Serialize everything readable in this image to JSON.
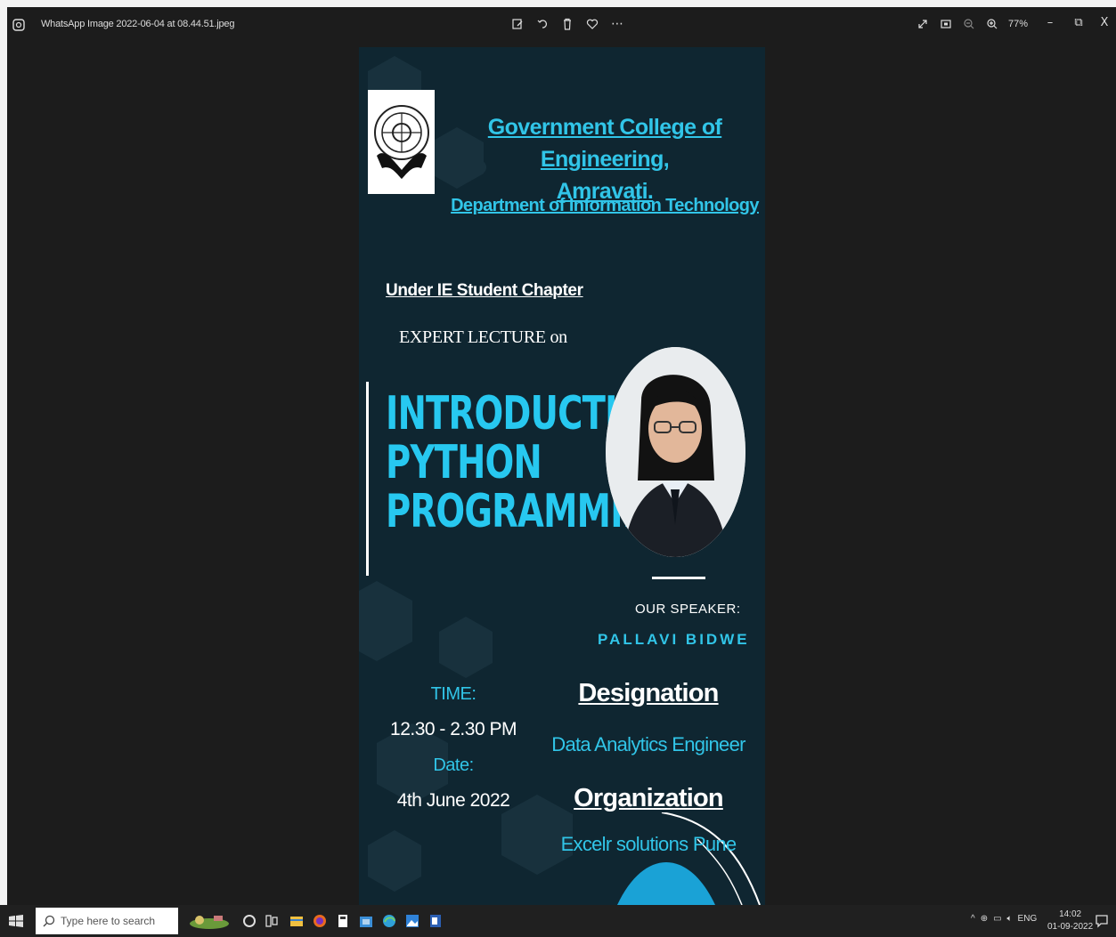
{
  "window": {
    "title": "WhatsApp Image 2022-06-04 at 08.44.51.jpeg",
    "zoom": "77%",
    "toolbar_icons": [
      "edit-icon",
      "rotate-icon",
      "delete-icon",
      "favorite-icon",
      "more-icon"
    ],
    "right_icons": [
      "fullscreen-icon",
      "fit-icon",
      "zoom-out-icon",
      "zoom-in-icon"
    ],
    "controls": {
      "minimize": "–",
      "restore": "⧉",
      "close": "X"
    }
  },
  "poster": {
    "college_line1": "Government College of Engineering,",
    "college_line2": "Amravati.",
    "department": "Department of Information Technology",
    "chapter": "Under IE Student Chapter",
    "lecture_intro": "EXPERT LECTURE on",
    "headline": [
      "INTRODUCTION TO",
      "PYTHON",
      "PROGRAMMING"
    ],
    "speaker_label": "OUR SPEAKER:",
    "speaker_name": "PALLAVI BIDWE",
    "time_label": "TIME:",
    "time_value": "12.30 - 2.30 PM",
    "date_label": "Date:",
    "date_value": "4th June 2022",
    "designation_label": "Designation",
    "designation_value": "Data Analytics Engineer",
    "organization_label": "Organization",
    "organization_value": "Excelr solutions Pune",
    "colors": {
      "background": "#0f2631",
      "accent": "#31c5e8",
      "text": "#ffffff"
    }
  },
  "taskbar": {
    "search_placeholder": "Type here to search",
    "tray_lang": "ENG",
    "time": "14:02",
    "date": "01-09-2022"
  }
}
